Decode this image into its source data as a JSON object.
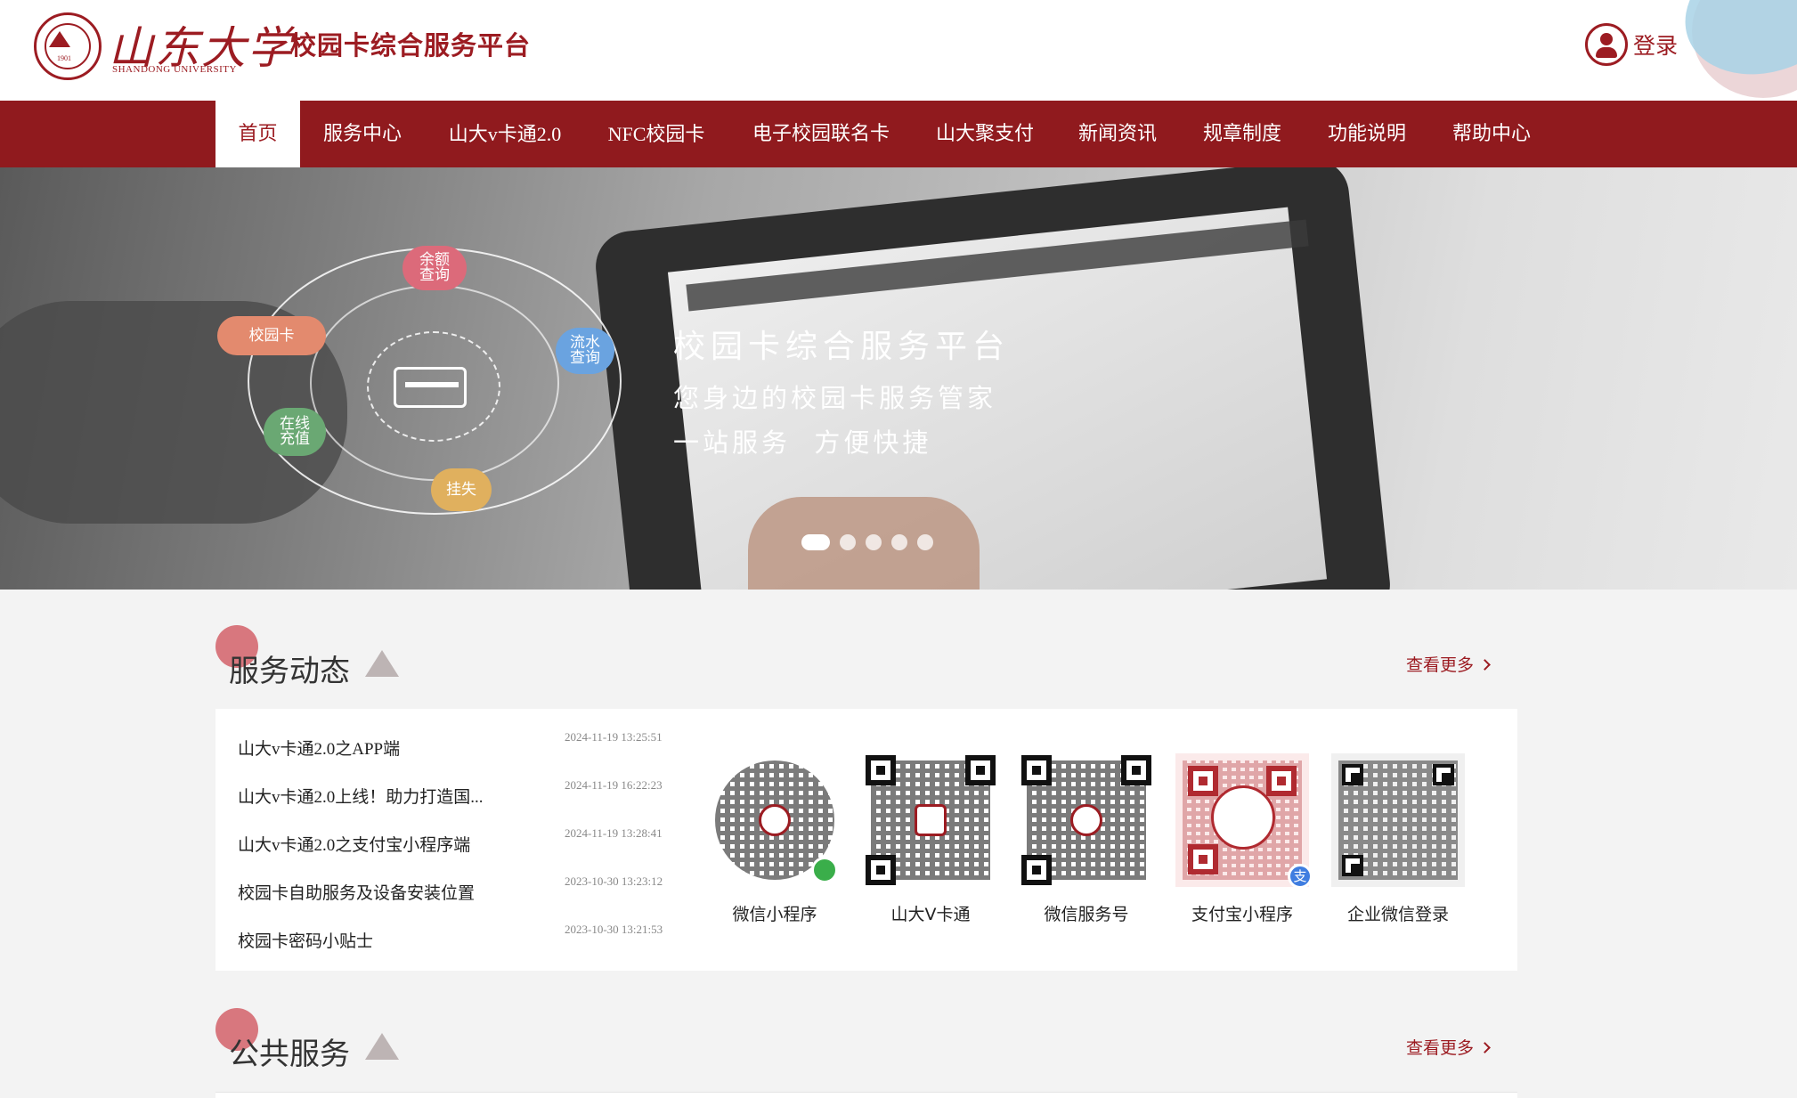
{
  "header": {
    "logo_name": "山东大学",
    "logo_en": "SHANDONG UNIVERSITY",
    "logo_year": "1901",
    "site_title": "校园卡综合服务平台",
    "login_label": "登录"
  },
  "nav": {
    "items": [
      {
        "label": "首页",
        "active": true
      },
      {
        "label": "服务中心"
      },
      {
        "label": "山大v卡通2.0"
      },
      {
        "label": "NFC校园卡"
      },
      {
        "label": "电子校园联名卡"
      },
      {
        "label": "山大聚支付"
      },
      {
        "label": "新闻资讯"
      },
      {
        "label": "规章制度"
      },
      {
        "label": "功能说明"
      },
      {
        "label": "帮助中心"
      }
    ]
  },
  "banner": {
    "title": "校园卡综合服务平台",
    "subtitle1": "您身边的校园卡服务管家",
    "subtitle2": "一站服务  方便快捷",
    "bubbles": {
      "balance": "余额\n查询",
      "card": "校园卡",
      "flow": "流水\n查询",
      "recharge": "在线\n充值",
      "lost": "挂失"
    },
    "slide_count": 5,
    "active_slide": 1
  },
  "service_news": {
    "title": "服务动态",
    "more_label": "查看更多",
    "items": [
      {
        "title": "山大v卡通2.0之APP端",
        "date": "2024-11-19 13:25:51"
      },
      {
        "title": "山大v卡通2.0上线！助力打造国...",
        "date": "2024-11-19 16:22:23"
      },
      {
        "title": "山大v卡通2.0之支付宝小程序端",
        "date": "2024-11-19 13:28:41"
      },
      {
        "title": "校园卡自助服务及设备安装位置",
        "date": "2023-10-30 13:23:12"
      },
      {
        "title": "校园卡密码小贴士",
        "date": "2023-10-30 13:21:53"
      }
    ]
  },
  "qr_codes": [
    {
      "label": "微信小程序",
      "icon": "wechat-mini-program-qr"
    },
    {
      "label": "山大V卡通",
      "icon": "vcard-app-qr"
    },
    {
      "label": "微信服务号",
      "icon": "wechat-service-qr"
    },
    {
      "label": "支付宝小程序",
      "icon": "alipay-mini-program-qr"
    },
    {
      "label": "企业微信登录",
      "icon": "wecom-login-qr"
    }
  ],
  "public_services": {
    "title": "公共服务",
    "more_label": "查看更多"
  },
  "colors": {
    "brand_red": "#9c1c22",
    "nav_red": "#901a1e",
    "section_circle": "#d8777e"
  }
}
